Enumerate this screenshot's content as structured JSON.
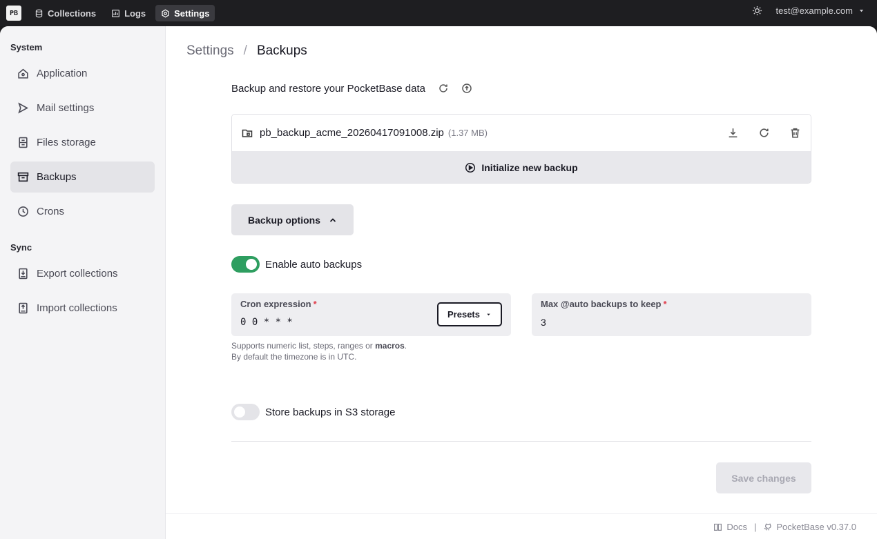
{
  "topbar": {
    "logo_text": "PB",
    "nav": [
      {
        "label": "Collections",
        "icon": "database-icon"
      },
      {
        "label": "Logs",
        "icon": "chart-icon"
      },
      {
        "label": "Settings",
        "icon": "gear-icon",
        "active": true
      }
    ],
    "user_email": "test@example.com"
  },
  "sidebar": {
    "system_heading": "System",
    "system_items": [
      {
        "label": "Application",
        "icon": "home-icon"
      },
      {
        "label": "Mail settings",
        "icon": "send-icon"
      },
      {
        "label": "Files storage",
        "icon": "storage-icon"
      },
      {
        "label": "Backups",
        "icon": "archive-icon",
        "active": true
      },
      {
        "label": "Crons",
        "icon": "clock-icon"
      }
    ],
    "sync_heading": "Sync",
    "sync_items": [
      {
        "label": "Export collections",
        "icon": "export-icon"
      },
      {
        "label": "Import collections",
        "icon": "import-icon"
      }
    ]
  },
  "breadcrumb": {
    "parent": "Settings",
    "separator": "/",
    "current": "Backups"
  },
  "backups": {
    "title": "Backup and restore your PocketBase data",
    "items": [
      {
        "name": "pb_backup_acme_20260417091008.zip",
        "size": "(1.37 MB)"
      }
    ],
    "init_label": "Initialize new backup"
  },
  "options": {
    "toggle_label": "Backup options",
    "auto_backups": {
      "label": "Enable auto backups",
      "enabled": true
    },
    "cron": {
      "label": "Cron expression",
      "required_mark": "*",
      "value": "0 0 * * *",
      "presets_label": "Presets",
      "help_line1_prefix": "Supports numeric list, steps, ranges or ",
      "help_line1_bold": "macros",
      "help_line1_suffix": ".",
      "help_line2": "By default the timezone is in UTC."
    },
    "max_keep": {
      "label": "Max @auto backups to keep",
      "required_mark": "*",
      "value": "3"
    },
    "s3": {
      "label": "Store backups in S3 storage",
      "enabled": false
    },
    "save_label": "Save changes"
  },
  "footer": {
    "docs": "Docs",
    "separator": "|",
    "version": "PocketBase v0.37.0"
  },
  "colors": {
    "accent_green": "#2e9e60",
    "required_red": "#e03b4a"
  }
}
